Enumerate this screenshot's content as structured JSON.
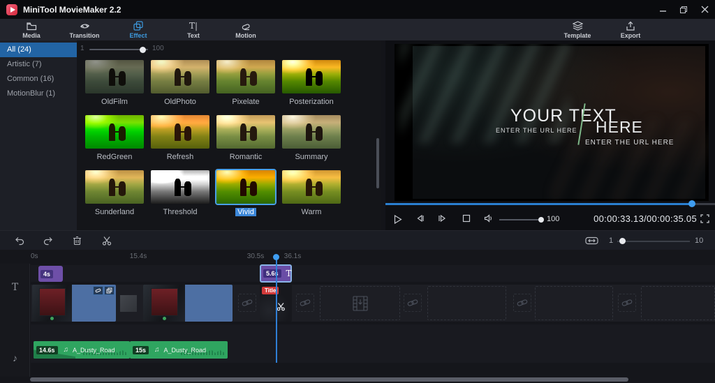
{
  "titlebar": {
    "title": "MiniTool MovieMaker 2.2"
  },
  "tabs": {
    "items": [
      {
        "label": "Media"
      },
      {
        "label": "Transition"
      },
      {
        "label": "Effect",
        "active": true
      },
      {
        "label": "Text"
      },
      {
        "label": "Motion"
      }
    ],
    "right": [
      {
        "label": "Template"
      },
      {
        "label": "Export"
      }
    ]
  },
  "sidebar": {
    "items": [
      {
        "label": "All (24)",
        "selected": true
      },
      {
        "label": "Artistic (7)"
      },
      {
        "label": "Common (16)"
      },
      {
        "label": "MotionBlur (1)"
      }
    ]
  },
  "effects": {
    "strength_min": "1",
    "strength_max": "100",
    "items": [
      {
        "name": "OldFilm"
      },
      {
        "name": "OldPhoto"
      },
      {
        "name": "Pixelate"
      },
      {
        "name": "Posterization"
      },
      {
        "name": "RedGreen"
      },
      {
        "name": "Refresh"
      },
      {
        "name": "Romantic"
      },
      {
        "name": "Summary"
      },
      {
        "name": "Sunderland"
      },
      {
        "name": "Threshold"
      },
      {
        "name": "Vivid",
        "selected": true
      },
      {
        "name": "Warm"
      }
    ]
  },
  "preview": {
    "overlay": {
      "line1": "YOUR TEXT",
      "line2": "HERE",
      "url_left": "ENTER THE URL HERE",
      "url_right": "ENTER THE URL HERE"
    },
    "volume": "100",
    "timecode": "00:00:33.13/00:00:35.05"
  },
  "timeline_toolbar": {
    "zoom_min": "1",
    "zoom_max": "10"
  },
  "ruler": {
    "marks": [
      {
        "label": "0s"
      },
      {
        "label": "15.4s"
      },
      {
        "label": "30.5s"
      },
      {
        "label": "36.1s"
      }
    ]
  },
  "tracks": {
    "text": {
      "clips": [
        {
          "duration": "4s"
        },
        {
          "duration": "5.6s",
          "selected": true
        }
      ]
    },
    "video": {
      "title_badge": "Title"
    },
    "music": {
      "clips": [
        {
          "duration": "14.6s",
          "name": "A_Dusty_Road"
        },
        {
          "duration": "15s",
          "name": "A_Dusty_Road"
        }
      ]
    }
  },
  "icons": {
    "music_note": "♫",
    "track_text": "T",
    "text_tab": "T|",
    "track_music": "♪"
  },
  "colors": {
    "accent": "#3d9be0",
    "selected_category": "#2264a4",
    "clip_purple": "#6e4fa8",
    "clip_blue": "#4d6fa3",
    "clip_green": "#2fa560",
    "seek_blue": "#2a7fd0",
    "title_badge_red": "#d23a3a"
  }
}
